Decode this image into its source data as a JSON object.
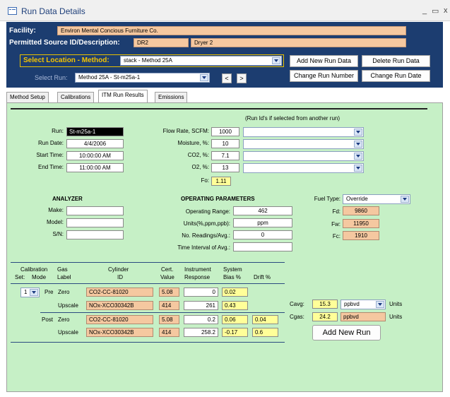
{
  "window": {
    "title": "Run Data Details",
    "min": "_",
    "max": "▭",
    "close": "x"
  },
  "header": {
    "facility_label": "Facility:",
    "facility_value": "Environ Mental Concious Furniture Co.",
    "source_label": "Permitted Source ID/Description:",
    "source_id": "DR2",
    "source_desc": "Dryer 2",
    "loc_label": "Select Location - Method:",
    "loc_value": "stack - Method 25A",
    "run_label": "Select Run:",
    "run_value": "Method 25A - St-m25a-1",
    "prev": "<",
    "next": ">",
    "btn_add": "Add New Run Data",
    "btn_delete": "Delete Run Data",
    "btn_change_number": "Change Run Number",
    "btn_change_date": "Change Run Date"
  },
  "tabs": [
    "Method Setup",
    "Calibrations",
    "ITM Run Results",
    "Emissions"
  ],
  "run": {
    "run_label": "Run:",
    "run": "St-m25a-1",
    "date_label": "Run Date:",
    "date": "4/4/2006",
    "start_label": "Start Time:",
    "start": "10:00:00 AM",
    "end_label": "End Time:",
    "end": "11:00:00 AM"
  },
  "flow": {
    "header": "(Run Id's if selected from another run)",
    "flow_label": "Flow Rate, SCFM:",
    "flow": "1000",
    "moist_label": "Moisture, %:",
    "moist": "10",
    "co2_label": "CO2, %:",
    "co2": "7.1",
    "o2_label": "O2, %:",
    "o2": "13",
    "fo_label": "Fo:",
    "fo": "1.11"
  },
  "analyzer": {
    "title": "ANALYZER",
    "make_label": "Make:",
    "make": "",
    "model_label": "Model:",
    "model": "",
    "sn_label": "S/N:",
    "sn": ""
  },
  "operating": {
    "title": "OPERATING PARAMETERS",
    "range_label": "Operating Range:",
    "range": "462",
    "units_label": "Units(%,ppm,ppb):",
    "units": "ppm",
    "readings_label": "No. Readings/Avg.:",
    "readings": "0",
    "interval_label": "Time Interval of Avg.:",
    "interval": ""
  },
  "fuel": {
    "type_label": "Fuel Type:",
    "type": "Override",
    "fd_label": "Fd:",
    "fd": "9860",
    "fw_label": "Fw:",
    "fw": "11950",
    "fc_label": "Fc:",
    "fc": "1910"
  },
  "cal_table": {
    "h_calset": "Calibration",
    "h_calset2": "Set:",
    "h_mode": "Mode",
    "h_gas": "Gas",
    "h_gas2": "Label",
    "h_cyl": "Cylinder",
    "h_cyl2": "ID",
    "h_cert": "Cert.",
    "h_cert2": "Value",
    "h_inst": "Instrument",
    "h_inst2": "Response",
    "h_sys": "System",
    "h_sys2": "Bias %",
    "h_drift": "Drift %",
    "set": "1",
    "rows": [
      {
        "mode": "Pre",
        "gas": "Zero",
        "cyl": "CO2-CC-81020",
        "cert": "5.08",
        "resp": "0",
        "bias": "0.02",
        "drift": ""
      },
      {
        "mode": "",
        "gas": "Upscale",
        "cyl": "NOx-XCO30342B",
        "cert": "414",
        "resp": "261",
        "bias": "0.43",
        "drift": ""
      },
      {
        "mode": "Post",
        "gas": "Zero",
        "cyl": "CO2-CC-81020",
        "cert": "5.08",
        "resp": "0.2",
        "bias": "0.06",
        "drift": "0.04"
      },
      {
        "mode": "",
        "gas": "Upscale",
        "cyl": "NOx-XCO30342B",
        "cert": "414",
        "resp": "258.2",
        "bias": "-0.17",
        "drift": "0.6"
      }
    ]
  },
  "conc": {
    "cavg_label": "Cavg:",
    "cavg": "15.3",
    "cavg_unit": "ppbvd",
    "units_label": "Units",
    "cgas_label": "Cgas:",
    "cgas": "24.2",
    "cgas_unit": "ppbvd",
    "units_label2": "Units"
  },
  "add_new_run": "Add New Run"
}
